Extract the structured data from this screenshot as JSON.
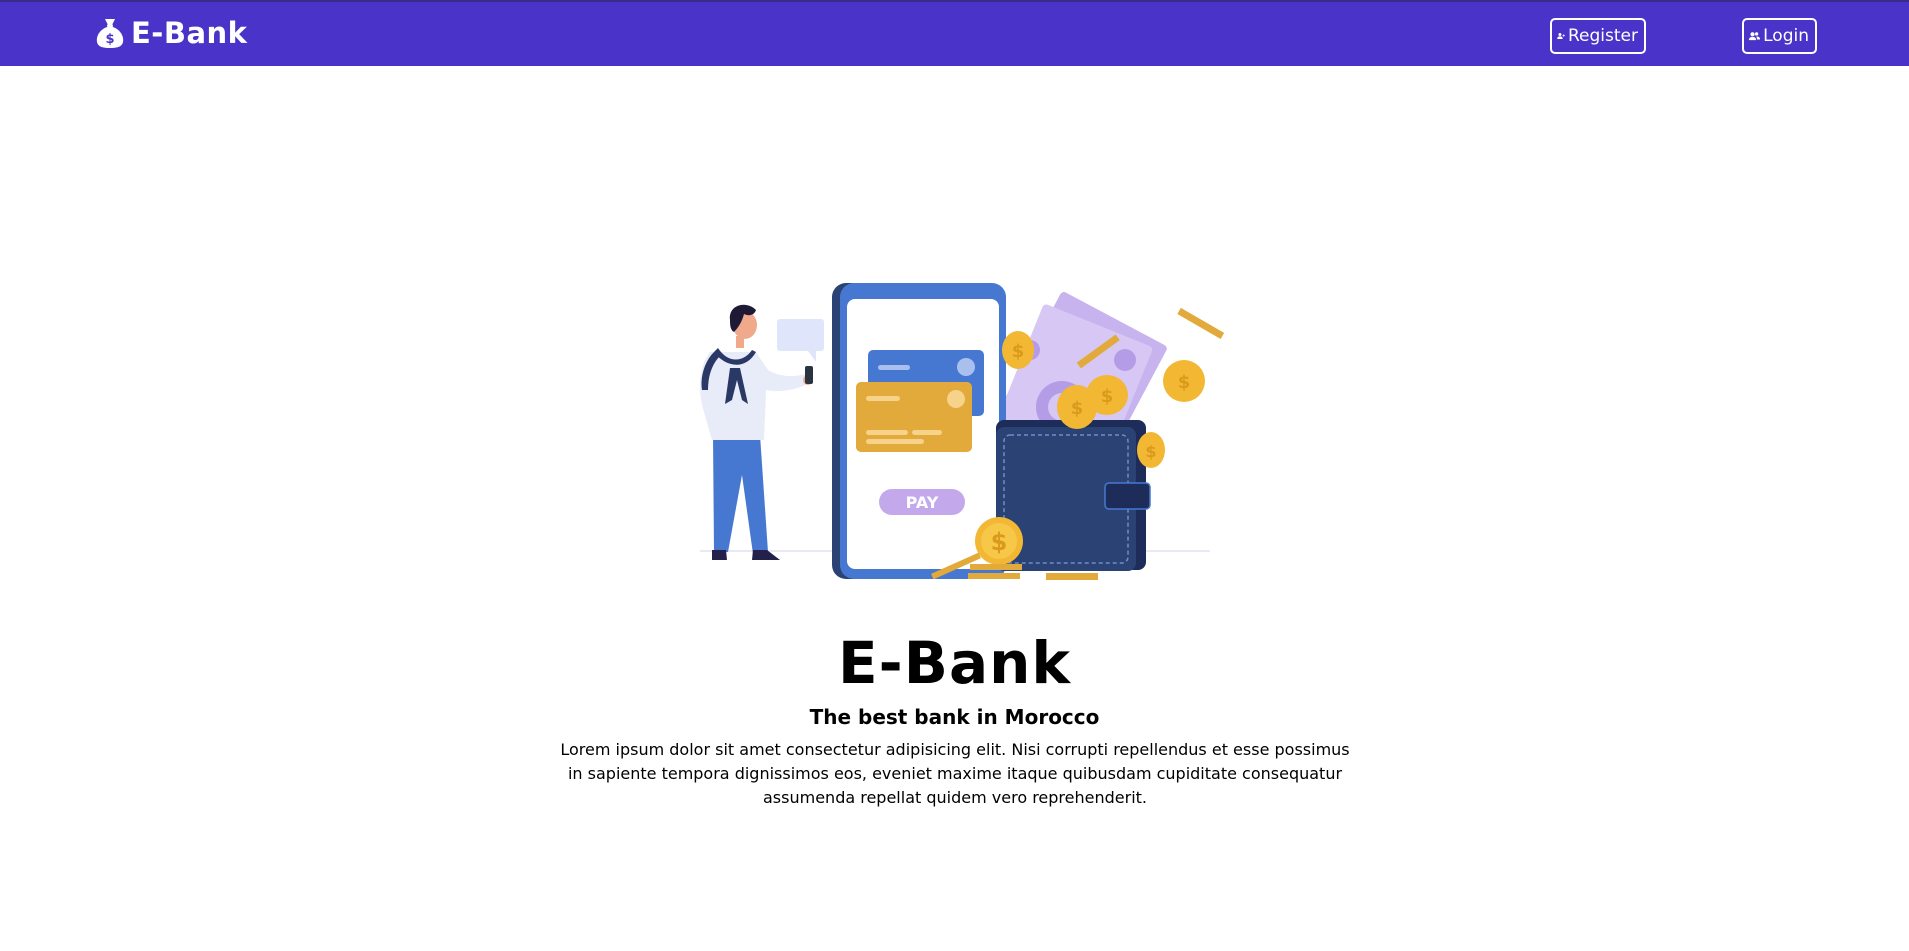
{
  "navbar": {
    "brand_text": "E-Bank",
    "brand_icon": "money-bag-icon",
    "register_label": "Register",
    "register_icon": "user-plus-icon",
    "login_label": "Login",
    "login_icon": "users-icon",
    "background_color": "#4a33c8"
  },
  "hero": {
    "illustration": {
      "pay_label": "PAY",
      "subject": "person paying with phone, credit cards, wallet, banknotes and coins"
    },
    "title": "E-Bank",
    "subtitle": "The best bank in Morocco",
    "description": "Lorem ipsum dolor sit amet consectetur adipisicing elit. Nisi corrupti repellendus et esse possimus in sapiente tempora dignissimos eos, eveniet maxime itaque quibusdam cupiditate consequatur assumenda repellat quidem vero reprehenderit."
  },
  "colors": {
    "brand": "#4a33c8",
    "white": "#ffffff",
    "phone_blue": "#4778d1",
    "card_gold": "#e2a93b",
    "wallet_navy": "#2a4374",
    "cash_lavender": "#c7b3ee",
    "coin_gold": "#f2b833"
  }
}
